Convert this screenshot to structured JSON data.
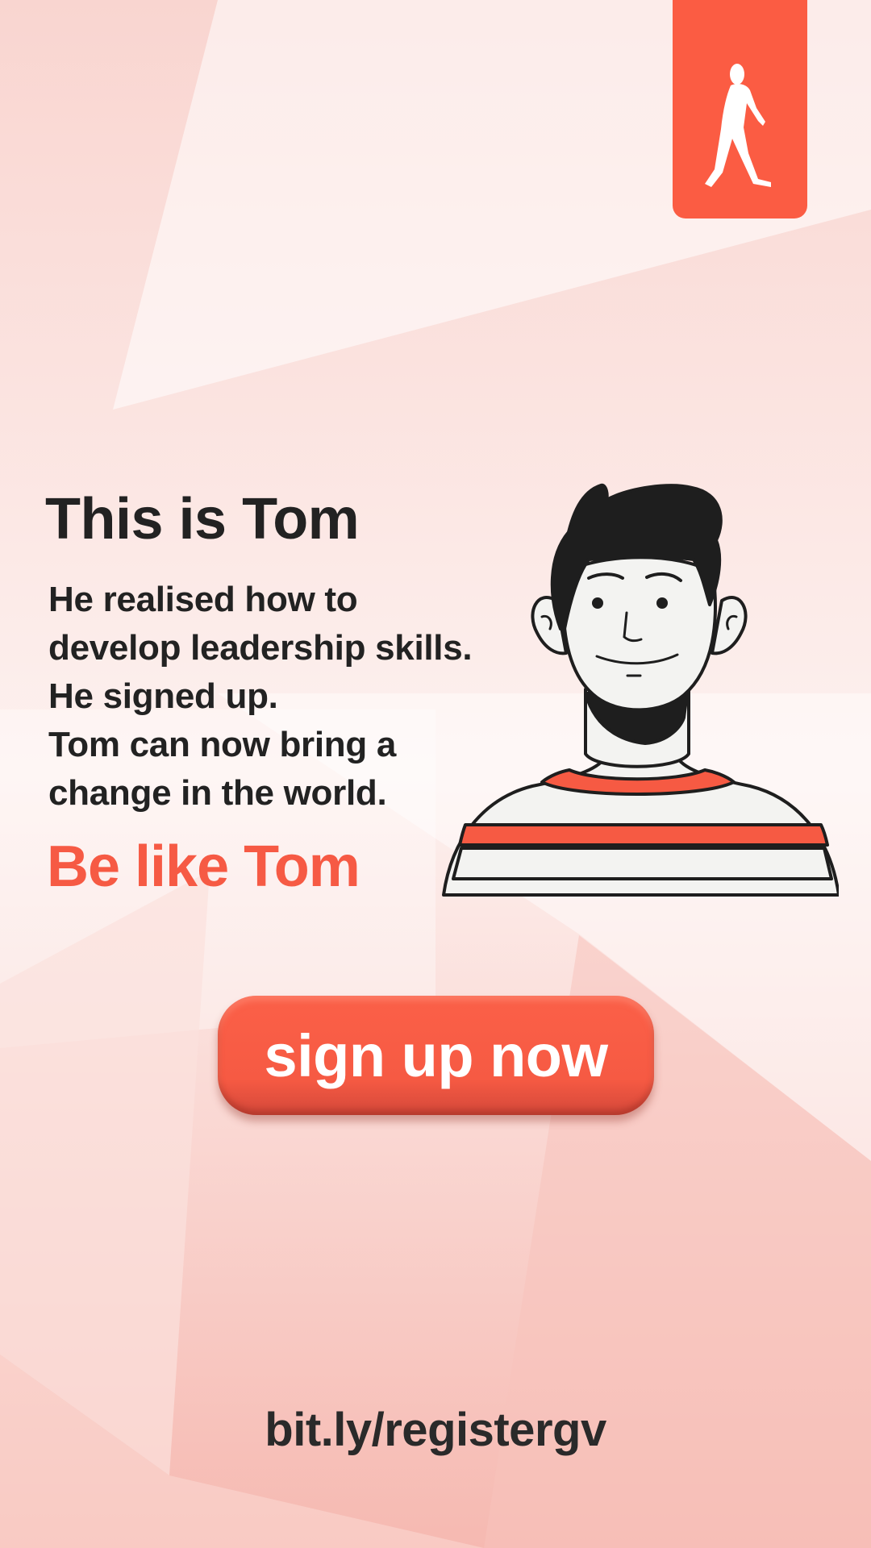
{
  "colors": {
    "accent": "#fb5c43",
    "text": "#222222",
    "background": "#fbe7e4"
  },
  "logo": {
    "icon": "walking-person-icon"
  },
  "hero": {
    "title": "This is Tom",
    "lines": [
      "He realised how to",
      "develop leadership skills.",
      "He signed up.",
      "Tom can now bring a",
      "change in the world."
    ],
    "tagline": "Be like Tom"
  },
  "illustration": {
    "icon": "man-portrait-illustration"
  },
  "cta": {
    "label": "sign up now"
  },
  "footer": {
    "url": "bit.ly/registergv"
  }
}
